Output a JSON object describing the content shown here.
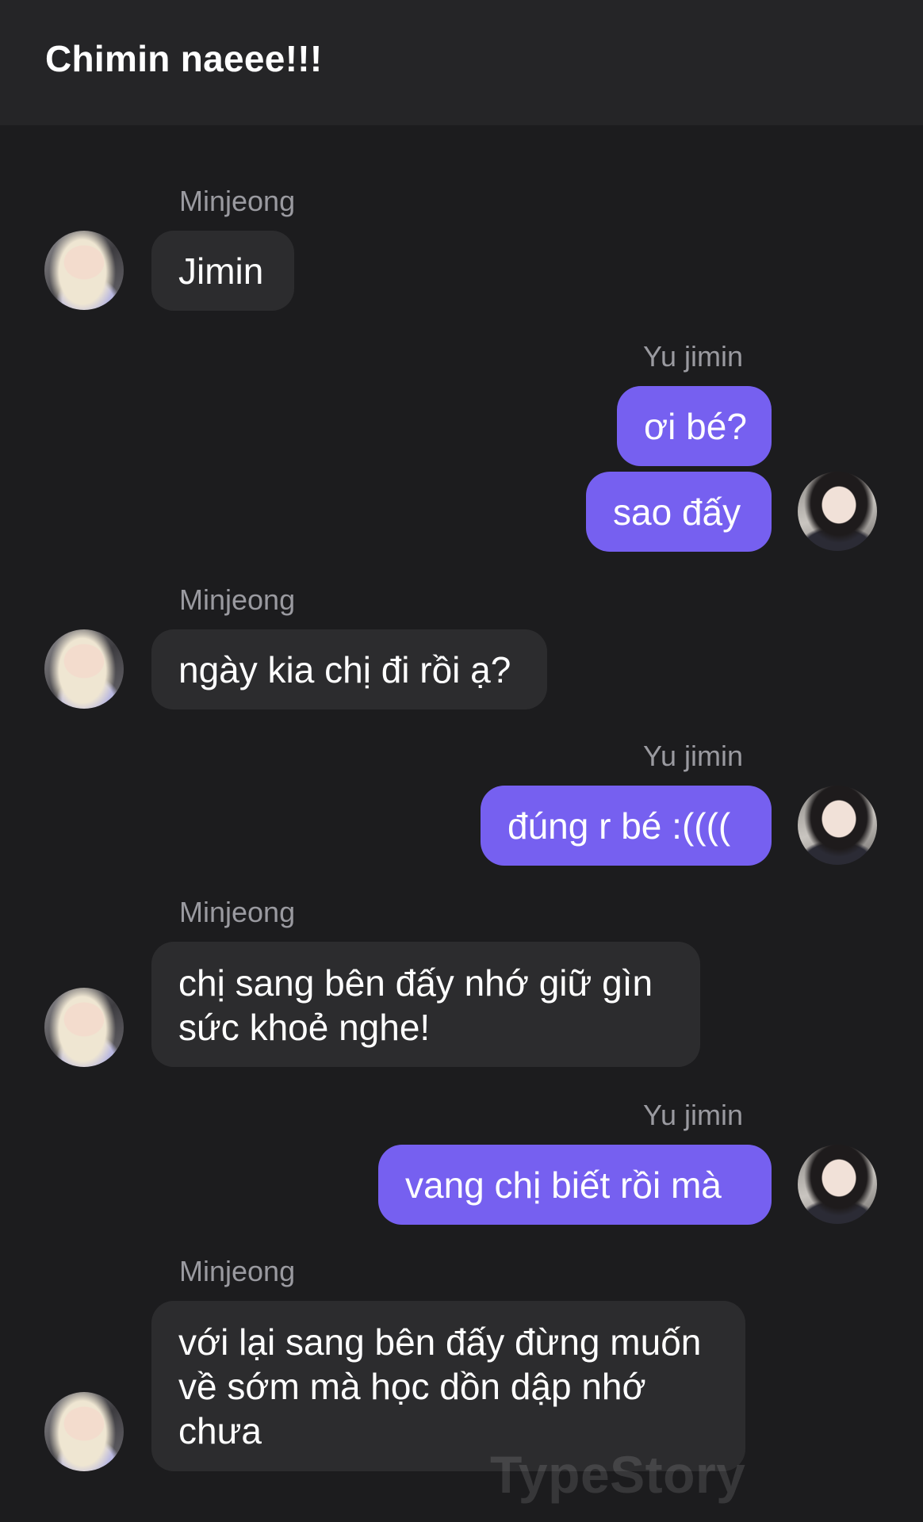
{
  "header": {
    "title": "Chimin naeee!!!"
  },
  "messages": [
    {
      "sender": "Minjeong",
      "text": "Jimin"
    },
    {
      "sender": "Yu jimin",
      "text": "ơi bé?"
    },
    {
      "sender": "Yu jimin",
      "text": "sao đấy"
    },
    {
      "sender": "Minjeong",
      "text": "ngày kia chị đi rồi ạ?"
    },
    {
      "sender": "Yu jimin",
      "text": "đúng r bé :(((("
    },
    {
      "sender": "Minjeong",
      "text": "chị sang bên đấy nhớ giữ gìn sức khoẻ nghe!"
    },
    {
      "sender": "Yu jimin",
      "text": "vang chị biết rồi mà"
    },
    {
      "sender": "Minjeong",
      "text": "với lại sang bên đấy đừng muốn về sớm mà học dồn dập nhớ chưa"
    }
  ],
  "watermark": "TypeStory",
  "colors": {
    "background": "#1c1c1e",
    "header": "#252527",
    "incoming_bubble": "#2c2c2e",
    "outgoing_bubble": "#7660f0",
    "sender_name": "#9a9aa0"
  }
}
